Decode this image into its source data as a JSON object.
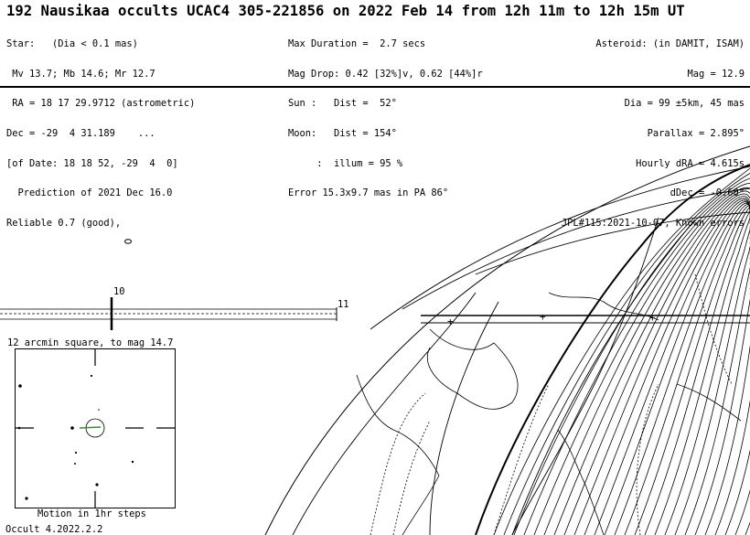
{
  "header": {
    "title": "192 Nausikaa occults UCAC4 305-221856 on 2022 Feb 14 from 12h 11m to 12h 15m UT",
    "star_lines": [
      "Star:   (Dia < 0.1 mas)",
      " Mv 13.7; Mb 14.6; Mr 12.7",
      " RA = 18 17 29.9712 (astrometric)",
      "Dec = -29  4 31.189    ...",
      "[of Date: 18 18 52, -29  4  0]",
      "  Prediction of 2021 Dec 16.0",
      "Reliable 0.7 (good),"
    ],
    "event_lines": [
      "Max Duration =  2.7 secs",
      "Mag Drop: 0.42 [32%]v, 0.62 [44%]r",
      "Sun :   Dist =  52°",
      "Moon:   Dist = 154°",
      "     :  illum = 95 %",
      "Error 15.3x9.7 mas in PA 86°"
    ],
    "asteroid_lines": [
      "Asteroid: (in DAMIT, ISAM)",
      "Mag = 12.9",
      "Dia = 99 ±5km, 45 mas",
      "Parallax = 2.895\"",
      "Hourly dRA = 4.615s",
      "dDec = -0.60\"",
      "JPL#115:2021-10-07, Known errors"
    ]
  },
  "motion_axis": {
    "label_start": "10",
    "label_end": "11"
  },
  "finder_chart": {
    "title": "12 arcmin square, to mag 14.7",
    "caption": "Motion in 1hr steps"
  },
  "footer": {
    "version": "Occult 4.2022.2.2"
  },
  "colors": {
    "ink": "#000000",
    "background": "#ffffff",
    "motion_arrow": "#3c8a3c"
  }
}
